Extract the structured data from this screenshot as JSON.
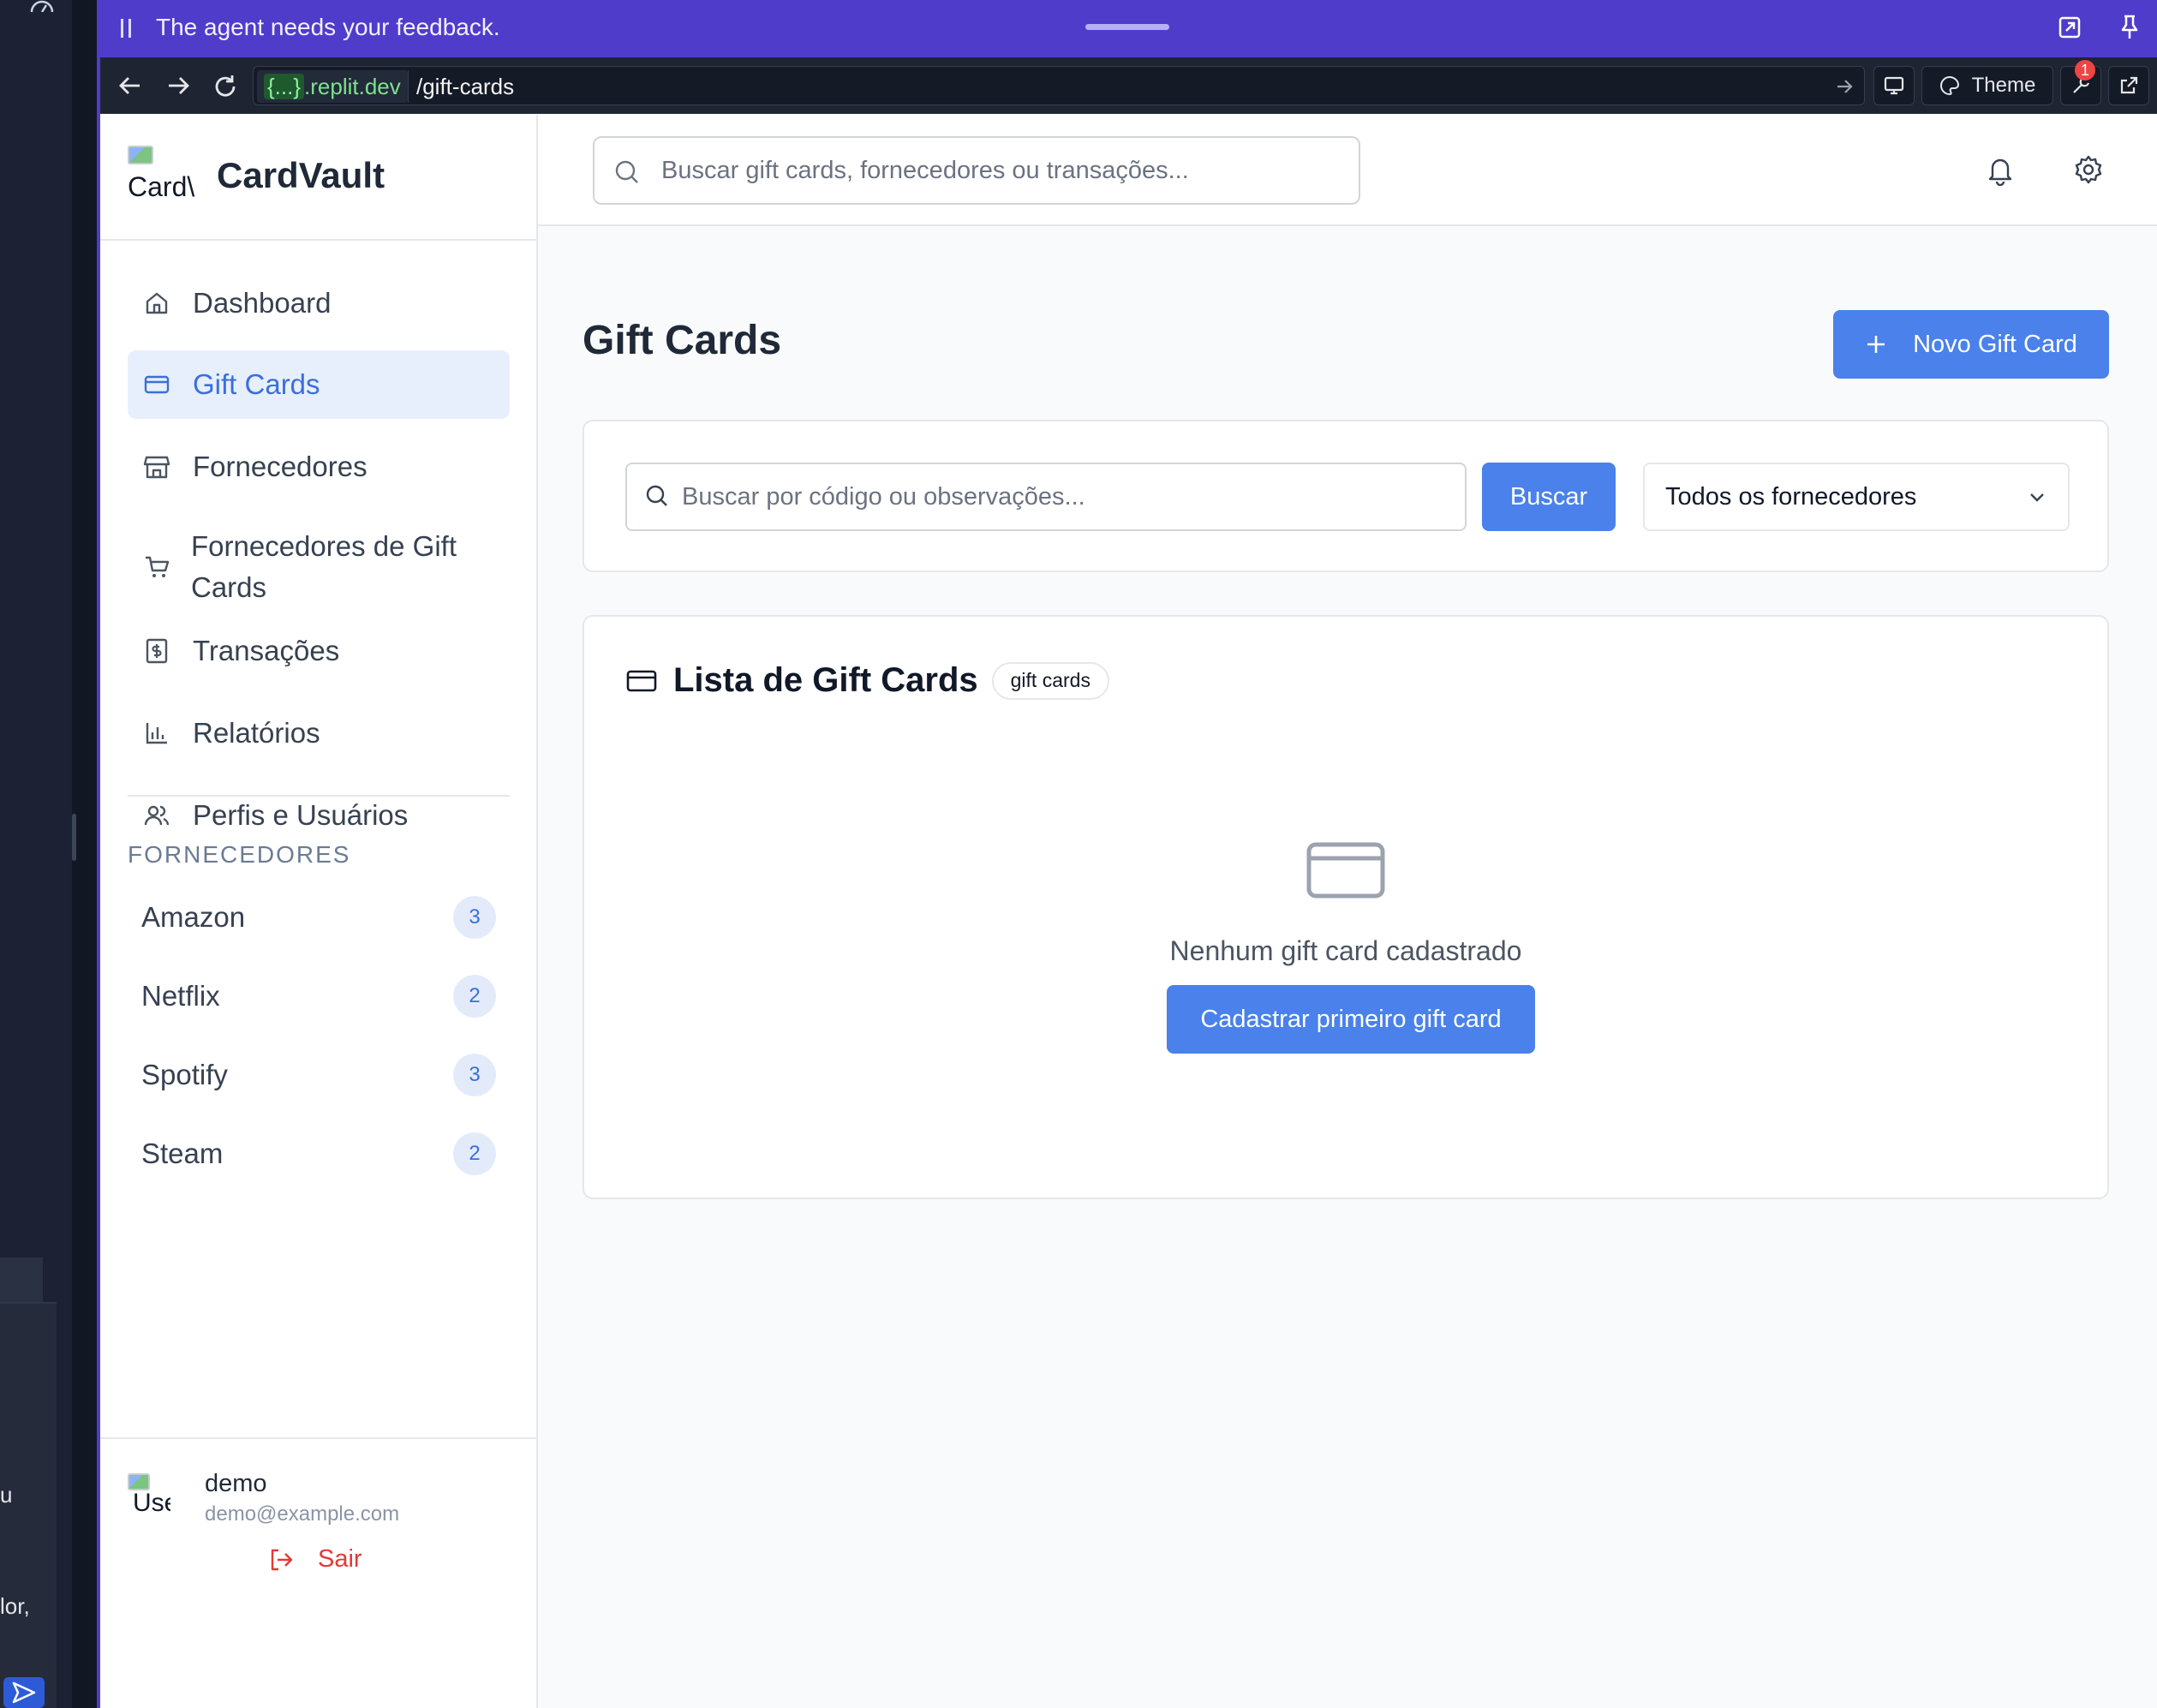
{
  "feedback_bar": {
    "message": "The agent needs your feedback."
  },
  "browser": {
    "host_placeholder": "{...}",
    "host_domain": ".replit.dev",
    "path": "/gift-cards",
    "theme_label": "Theme",
    "notifications_count": "1"
  },
  "brand": {
    "logo_alt": "Card\\",
    "name": "CardVault"
  },
  "sidebar": {
    "items": [
      {
        "label": "Dashboard",
        "icon": "home-icon",
        "active": false
      },
      {
        "label": "Gift Cards",
        "icon": "credit-card-icon",
        "active": true
      },
      {
        "label": "Fornecedores",
        "icon": "store-icon",
        "active": false
      },
      {
        "label": "Fornecedores de Gift Cards",
        "icon": "shopping-cart-icon",
        "active": false
      },
      {
        "label": "Transações",
        "icon": "receipt-dollar-icon",
        "active": false
      },
      {
        "label": "Relatórios",
        "icon": "bar-chart-icon",
        "active": false
      },
      {
        "label": "Perfis e Usuários",
        "icon": "users-icon",
        "active": false
      }
    ],
    "section_label": "FORNECEDORES",
    "suppliers": [
      {
        "name": "Amazon",
        "count": "3"
      },
      {
        "name": "Netflix",
        "count": "2"
      },
      {
        "name": "Spotify",
        "count": "3"
      },
      {
        "name": "Steam",
        "count": "2"
      }
    ],
    "user": {
      "avatar_alt": "Use",
      "name": "demo",
      "email": "demo@example.com",
      "logout_label": "Sair"
    }
  },
  "topbar": {
    "search_placeholder": "Buscar gift cards, fornecedores ou transações..."
  },
  "main": {
    "title": "Gift Cards",
    "new_button": "Novo Gift Card",
    "filter": {
      "search_placeholder": "Buscar por código ou observações...",
      "search_button": "Buscar",
      "supplier_select": "Todos os fornecedores"
    },
    "list": {
      "title": "Lista de Gift Cards",
      "tag": "gift cards",
      "empty_text": "Nenhum gift card cadastrado",
      "empty_button": "Cadastrar primeiro gift card"
    }
  },
  "outer_panel": {
    "fragment_1": "u",
    "fragment_2": "lor,"
  },
  "colors": {
    "accent": "#4a81ea",
    "window_border": "#4f3ccb",
    "danger": "#e53935"
  }
}
